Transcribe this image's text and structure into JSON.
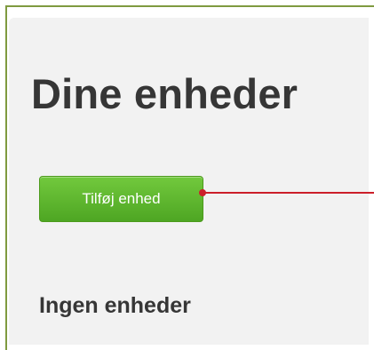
{
  "devices": {
    "title": "Dine enheder",
    "add_button_label": "Tilføj enhed",
    "empty_text": "Ingen enheder"
  },
  "colors": {
    "frame_border": "#7f9a40",
    "panel_background": "#f2f2f2",
    "button_green": "#5cb82e",
    "callout_red": "#cc1f2a",
    "heading_text": "#363636"
  }
}
